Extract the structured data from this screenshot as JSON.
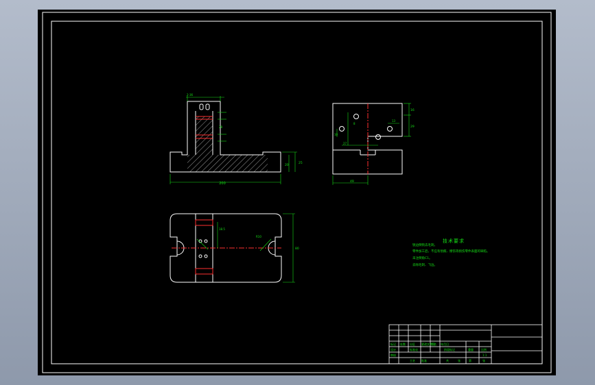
{
  "colors": {
    "background": "#000000",
    "frame": "#ffffff",
    "outline": "#ffffff",
    "dimension": "#16e016",
    "section": "#ff3030",
    "hatch": "#ffffff"
  },
  "front_view": {
    "dim_width": "200",
    "dim_height_left": "20",
    "dim_height_right": "25",
    "dim_top": "2-36",
    "dim_slot": "28"
  },
  "side_view": {
    "dim_bottom": "49",
    "dim_right_1": "16",
    "dim_right_2": "29",
    "dim_left": "10",
    "dim_inner": "13",
    "dim_27": "27",
    "dim_8": "8"
  },
  "top_view": {
    "dim_height": "80",
    "dim_left": "18.5",
    "dim_r": "R10"
  },
  "tech_req": {
    "title": "技术要求",
    "lines": [
      "锐边倒钝去毛刺。",
      "零件加工后，不应有划痕、擦伤等损伤零件表面的缺陷。",
      "未注倒角C1。",
      "去除毛刺、飞边。"
    ]
  },
  "title_block": {
    "cells": [
      "标记",
      "处数",
      "分区",
      "更改文件号",
      "签名",
      "年月日",
      "设计",
      "标准化",
      "阶段标记",
      "重量",
      "比例",
      "审核",
      "工艺",
      "批准",
      "共",
      "张",
      "第",
      "张",
      "1:1"
    ]
  }
}
